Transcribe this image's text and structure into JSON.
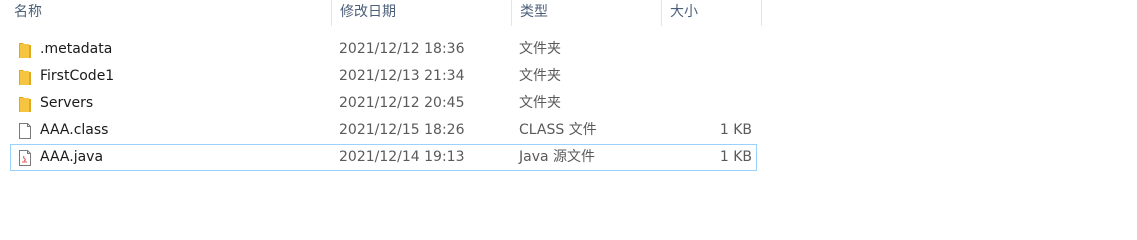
{
  "columns": {
    "name": "名称",
    "date": "修改日期",
    "type": "类型",
    "size": "大小"
  },
  "files": [
    {
      "name": ".metadata",
      "date": "2021/12/12 18:36",
      "type": "文件夹",
      "size": "",
      "icon": "folder-icon"
    },
    {
      "name": "FirstCode1",
      "date": "2021/12/13 21:34",
      "type": "文件夹",
      "size": "",
      "icon": "folder-icon"
    },
    {
      "name": "Servers",
      "date": "2021/12/12 20:45",
      "type": "文件夹",
      "size": "",
      "icon": "folder-icon"
    },
    {
      "name": "AAA.class",
      "date": "2021/12/15 18:26",
      "type": "CLASS 文件",
      "size": "1 KB",
      "icon": "file-icon"
    },
    {
      "name": "AAA.java",
      "date": "2021/12/14 19:13",
      "type": "Java 源文件",
      "size": "1 KB",
      "icon": "java-file-icon"
    }
  ],
  "colors": {
    "folder": "#f5c542",
    "folder_dark": "#e0a820",
    "selection_border": "#99d1ff",
    "header_text": "#4c607a"
  }
}
